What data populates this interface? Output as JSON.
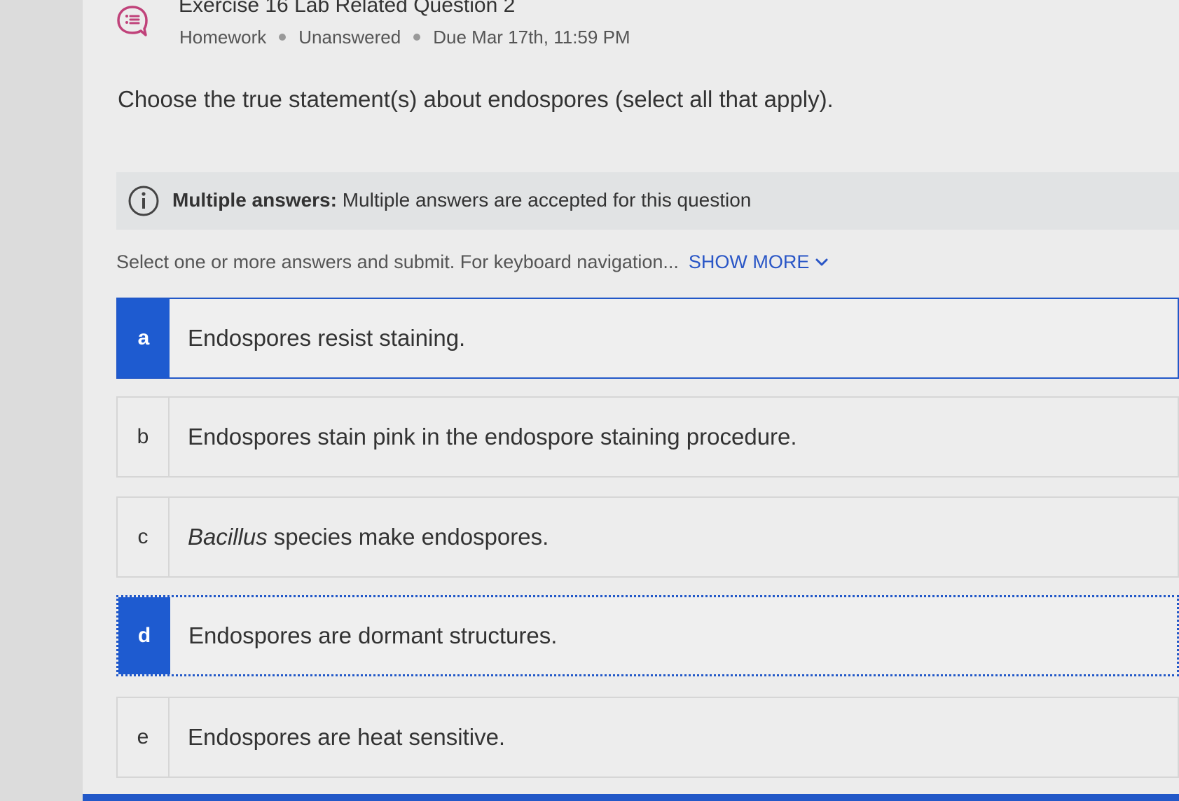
{
  "header": {
    "title": "Exercise 16 Lab Related Question 2",
    "meta": [
      "Homework",
      "Unanswered",
      "Due Mar 17th, 11:59 PM"
    ],
    "icon": "question-list-icon",
    "accent_color": "#c0427a"
  },
  "question": {
    "text": "Choose the true statement(s) about endospores (select all that apply)."
  },
  "info": {
    "icon": "info-icon",
    "label": "Multiple answers:",
    "text": "Multiple answers are accepted for this question"
  },
  "instructions": {
    "text": "Select one or more answers and submit. For keyboard navigation...",
    "show_more": "SHOW MORE"
  },
  "options": [
    {
      "letter": "a",
      "text": "Endospores resist staining.",
      "selected": true
    },
    {
      "letter": "b",
      "text": "Endospores stain pink in the endospore staining procedure.",
      "selected": false
    },
    {
      "letter": "c",
      "italic_prefix": "Bacillus",
      "text": "species make endospores.",
      "selected": false
    },
    {
      "letter": "d",
      "text": "Endospores are dormant structures.",
      "selected": true
    },
    {
      "letter": "e",
      "text": "Endospores are heat sensitive.",
      "selected": false
    }
  ],
  "colors": {
    "selected": "#1e5bd0",
    "link": "#2a56c6"
  }
}
